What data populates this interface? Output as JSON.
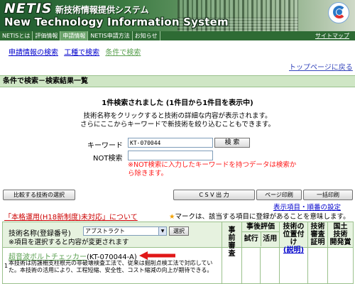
{
  "header": {
    "logo_netis": "NETIS",
    "system_name_jp": "新技術情報提供システム",
    "system_name_en": "New Technology Information System"
  },
  "nav": {
    "items": [
      {
        "label": "NETISとは"
      },
      {
        "label": "評価情報"
      },
      {
        "label": "申請情報"
      },
      {
        "label": "NETIS申請方法"
      },
      {
        "label": "お知らせ"
      }
    ],
    "sitemap": "サイトマップ"
  },
  "subtabs": [
    {
      "label": "申請情報の検索"
    },
    {
      "label": "工種で検索"
    },
    {
      "label": "条件で検索"
    }
  ],
  "top_link": "トップページに戻る",
  "section_title": "条件で検索－検索結果一覧",
  "result_count": "1件検索されました (1件目から1件目を表示中)",
  "instructions": {
    "line1": "技術名称をクリックすると技術の詳細な内容が表示されます。",
    "line2": "さらにここからキーワードで新技術を絞り込むこともできます。"
  },
  "search": {
    "keyword_label": "キーワード",
    "keyword_value": "KT-070044",
    "not_label": "NOT検索",
    "not_value": "",
    "search_button": "検 索",
    "not_note": "※NOT検索に入力したキーワードを持つデータは検索から除きます。"
  },
  "buttons": {
    "compare": "比較する技術の選択",
    "csv": "C S V 出 力",
    "print": "ページ印刷",
    "bulk_print": "一括印刷"
  },
  "settings_link": "表示項目・順番の設定",
  "status_link": "「本格運用(H18新制度)未対応」について",
  "star_note": {
    "star": "★",
    "text": "マークは、該当する項目に登録があることを意味します。"
  },
  "table": {
    "sort_label": "技術名称(登録番号)",
    "sort_select_value": "アブストラクト",
    "sort_button": "選択",
    "sort_note": "※項目を選択すると内容が変更されます",
    "col_prior": "事前審査",
    "col_post": "事後評価",
    "col_post_trial": "試行",
    "col_post_use": "活用",
    "col_position_1": "技術の",
    "col_position_2": "位置付け",
    "col_position_link": "(説明)",
    "col_certify_1": "技術",
    "col_certify_2": "審査",
    "col_certify_3": "証明",
    "col_national_1": "国土",
    "col_national_2": "技術",
    "col_national_3": "開発賞",
    "rows": [
      {
        "number": "1",
        "tech_name": "超音波ボルトチェッカー",
        "reg_number": "(KT-070044-A)",
        "description": "本技術は防護柵支柱根元の非破壊検査工法で、従来は掘削点検工法で対応していた。本技術の活用により、工程短縮、安全性、コスト縮減の向上が期待できる。"
      }
    ]
  }
}
